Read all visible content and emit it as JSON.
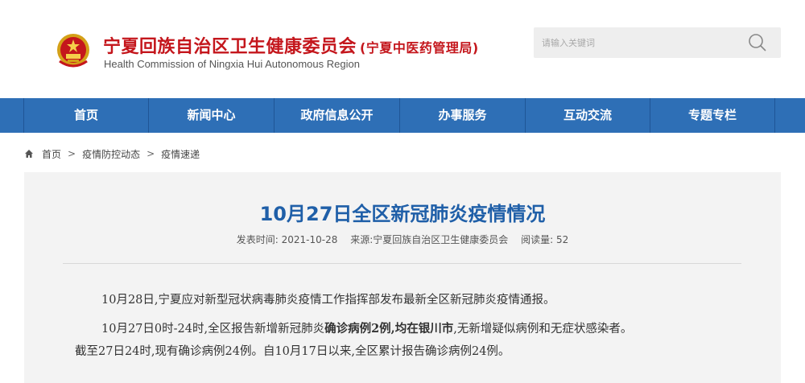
{
  "header": {
    "title_cn": "宁夏回族自治区卫生健康委员会",
    "title_sub": "(宁夏中医药管理局)",
    "title_en": "Health Commission of Ningxia Hui Autonomous Region"
  },
  "search": {
    "placeholder": "请输入关键词"
  },
  "nav": {
    "items": [
      "首页",
      "新闻中心",
      "政府信息公开",
      "办事服务",
      "互动交流",
      "专题专栏"
    ]
  },
  "breadcrumb": {
    "items": [
      "首页",
      "疫情防控动态",
      "疫情速递"
    ],
    "separator": ">"
  },
  "article": {
    "title": "10月27日全区新冠肺炎疫情情况",
    "date_label": "发表时间:",
    "date": "2021-10-28",
    "source_label": "来源:",
    "source": "宁夏回族自治区卫生健康委员会",
    "views_label": "阅读量:",
    "views": "52",
    "p1": "10月28日,宁夏应对新型冠状病毒肺炎疫情工作指挥部发布最新全区新冠肺炎疫情通报。",
    "p2_a": "10月27日0时-24时,全区报告新增新冠肺炎",
    "p2_b": "确诊病例2例,均在银川市",
    "p2_c": ",无新增疑似病例和无症状感染者。",
    "p3": "截至27日24时,现有确诊病例24例。自10月17日以来,全区累计报告确诊病例24例。"
  },
  "colors": {
    "brand_red": "#c4161c",
    "nav_blue": "#2e6fb6",
    "title_blue": "#1f5fa8"
  }
}
